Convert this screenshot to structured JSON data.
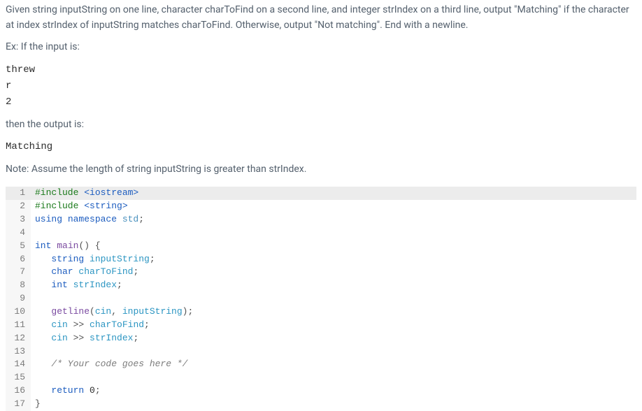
{
  "problem": {
    "instructions": "Given string inputString on one line, character charToFind on a second line, and integer strIndex on a third line, output \"Matching\" if the character at index strIndex of inputString matches charToFind. Otherwise, output \"Not matching\". End with a newline.",
    "example_lead": "Ex: If the input is:",
    "example_input": "threw\nr\n2",
    "then_output": "then the output is:",
    "example_output": "Matching",
    "note": "Note: Assume the length of string inputString is greater than strIndex."
  },
  "code": {
    "lines": [
      {
        "n": "1",
        "highlight": true,
        "tokens": [
          {
            "t": "#include ",
            "c": "tok-pre"
          },
          {
            "t": "<iostream>",
            "c": "header-inc"
          }
        ]
      },
      {
        "n": "2",
        "tokens": [
          {
            "t": "#include ",
            "c": "tok-pre"
          },
          {
            "t": "<string>",
            "c": "header-inc"
          }
        ]
      },
      {
        "n": "3",
        "tokens": [
          {
            "t": "using ",
            "c": "tok-kw"
          },
          {
            "t": "namespace ",
            "c": "tok-kw"
          },
          {
            "t": "std",
            "c": "tok-ns"
          },
          {
            "t": ";",
            "c": "tok-punc"
          }
        ]
      },
      {
        "n": "4",
        "tokens": []
      },
      {
        "n": "5",
        "tokens": [
          {
            "t": "int ",
            "c": "tok-type"
          },
          {
            "t": "main",
            "c": "tok-func"
          },
          {
            "t": "() {",
            "c": "tok-punc"
          }
        ]
      },
      {
        "n": "6",
        "tokens": [
          {
            "t": "   ",
            "c": ""
          },
          {
            "t": "string ",
            "c": "tok-type"
          },
          {
            "t": "inputString",
            "c": "tok-ident"
          },
          {
            "t": ";",
            "c": "tok-punc"
          }
        ]
      },
      {
        "n": "7",
        "tokens": [
          {
            "t": "   ",
            "c": ""
          },
          {
            "t": "char ",
            "c": "tok-type"
          },
          {
            "t": "charToFind",
            "c": "tok-ident"
          },
          {
            "t": ";",
            "c": "tok-punc"
          }
        ]
      },
      {
        "n": "8",
        "tokens": [
          {
            "t": "   ",
            "c": ""
          },
          {
            "t": "int ",
            "c": "tok-type"
          },
          {
            "t": "strIndex",
            "c": "tok-ident"
          },
          {
            "t": ";",
            "c": "tok-punc"
          }
        ]
      },
      {
        "n": "9",
        "tokens": []
      },
      {
        "n": "10",
        "tokens": [
          {
            "t": "   ",
            "c": ""
          },
          {
            "t": "getline",
            "c": "tok-func"
          },
          {
            "t": "(",
            "c": "tok-punc"
          },
          {
            "t": "cin",
            "c": "tok-ident"
          },
          {
            "t": ", ",
            "c": "tok-punc"
          },
          {
            "t": "inputString",
            "c": "tok-ident"
          },
          {
            "t": ");",
            "c": "tok-punc"
          }
        ]
      },
      {
        "n": "11",
        "tokens": [
          {
            "t": "   ",
            "c": ""
          },
          {
            "t": "cin",
            "c": "tok-ident"
          },
          {
            "t": " >> ",
            "c": "tok-punc"
          },
          {
            "t": "charToFind",
            "c": "tok-ident"
          },
          {
            "t": ";",
            "c": "tok-punc"
          }
        ]
      },
      {
        "n": "12",
        "tokens": [
          {
            "t": "   ",
            "c": ""
          },
          {
            "t": "cin",
            "c": "tok-ident"
          },
          {
            "t": " >> ",
            "c": "tok-punc"
          },
          {
            "t": "strIndex",
            "c": "tok-ident"
          },
          {
            "t": ";",
            "c": "tok-punc"
          }
        ]
      },
      {
        "n": "13",
        "tokens": []
      },
      {
        "n": "14",
        "tokens": [
          {
            "t": "   ",
            "c": ""
          },
          {
            "t": "/* Your code goes here */",
            "c": "tok-comm"
          }
        ]
      },
      {
        "n": "15",
        "tokens": []
      },
      {
        "n": "16",
        "tokens": [
          {
            "t": "   ",
            "c": ""
          },
          {
            "t": "return ",
            "c": "tok-kw"
          },
          {
            "t": "0",
            "c": "tok-num"
          },
          {
            "t": ";",
            "c": "tok-punc"
          }
        ]
      },
      {
        "n": "17",
        "tokens": [
          {
            "t": "}",
            "c": "tok-punc"
          }
        ]
      }
    ]
  }
}
